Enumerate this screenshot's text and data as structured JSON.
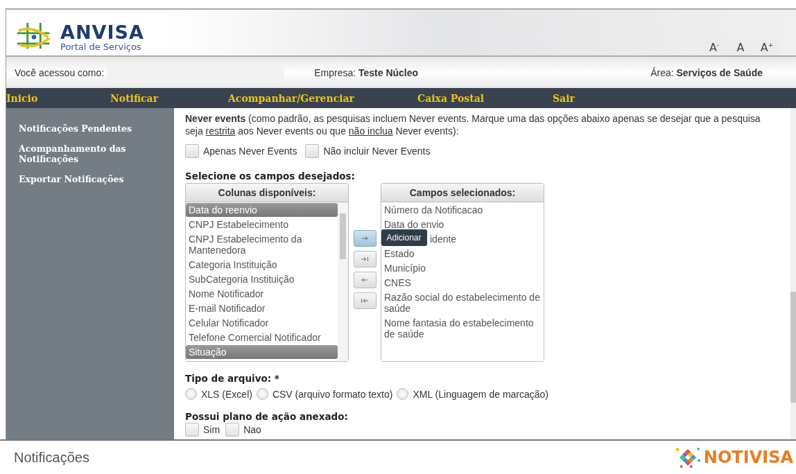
{
  "header": {
    "logo_title": "ANVISA",
    "logo_subtitle": "Portal de Serviços",
    "font_buttons": [
      {
        "main": "A",
        "sup": "-"
      },
      {
        "main": "A"
      },
      {
        "main": "A",
        "sup": "+"
      }
    ]
  },
  "info_bar": {
    "user_label": "Você acessou como:",
    "company_label": "Empresa:",
    "company": "Teste Núcleo",
    "area_label": "Área:",
    "area": "Serviços de Saúde"
  },
  "nav": [
    "Inicio",
    "Notificar",
    "Acompanhar/Gerenciar",
    "Caixa Postal",
    "Sair"
  ],
  "sidebar": {
    "items": [
      "Notificações Pendentes",
      "Acompanhamento das Notificações",
      "Exportar Notificações"
    ]
  },
  "never_events": {
    "text": [
      {
        "text": "**Never events** (como padrão, as pesquisas incluem Never events. Marque uma das opções abaixo apenas se desejar que a pesquisa seja ",
        "underline": false
      },
      {
        "text": "restrita",
        "underline": true
      },
      {
        "text": " aos Never events ou que ",
        "underline": false
      },
      {
        "text": "não inclua",
        "underline": true
      },
      {
        "text": " Never events):",
        "underline": false
      }
    ],
    "options": [
      {
        "label": "Apenas Never Events",
        "checked": false
      },
      {
        "label": "Não incluir Never Events",
        "checked": false
      }
    ]
  },
  "fields": {
    "title": "Selecione os campos desejados:",
    "available_title": "Colunas disponíveis:",
    "available": [
      {
        "label": "Data do reenvio",
        "selected": true
      },
      {
        "label": "CNPJ Estabelecimento",
        "selected": false
      },
      {
        "label": "CNPJ Estabelecimento da Mantenedora",
        "selected": false
      },
      {
        "label": "Categoria Instituição",
        "selected": false
      },
      {
        "label": "SubCategoria Instituição",
        "selected": false
      },
      {
        "label": "Nome Notificador",
        "selected": false
      },
      {
        "label": "E-mail Notificador",
        "selected": false
      },
      {
        "label": "Celular Notificador",
        "selected": false
      },
      {
        "label": "Telefone Comercial Notificador",
        "selected": false
      },
      {
        "label": "Situação",
        "selected": true
      }
    ],
    "buttons": [
      {
        "kind": "add",
        "active": true
      },
      {
        "kind": "add_all",
        "active": false
      },
      {
        "kind": "remove",
        "active": false
      },
      {
        "kind": "remove_all",
        "active": false
      }
    ],
    "tooltip": "Adicionar",
    "selected_title": "Campos selecionados:",
    "selected_fields": [
      {
        "label": "Número da Notificacao",
        "covered": false
      },
      {
        "label": "Data do envio",
        "covered": false
      },
      {
        "label": "idente",
        "covered": true
      },
      {
        "label": "Estado",
        "covered": false
      },
      {
        "label": "Município",
        "covered": false
      },
      {
        "label": "CNES",
        "covered": false
      },
      {
        "label": "Razão social do estabelecimento de saúde",
        "covered": false
      },
      {
        "label": "Nome fantasia do estabelecimento de saúde",
        "covered": false
      }
    ]
  },
  "file_type": {
    "title": "Tipo de arquivo: *",
    "options": [
      {
        "label": "XLS (Excel)",
        "selected": false
      },
      {
        "label": "CSV (arquivo formato texto)",
        "selected": false
      },
      {
        "label": "XML (Linguagem de marcação)",
        "selected": false
      }
    ]
  },
  "action_plan": {
    "title": "Possui plano de ação anexado:",
    "options": [
      {
        "label": "Sim",
        "checked": false
      },
      {
        "label": "Nao",
        "checked": false
      }
    ]
  },
  "footer": {
    "title": "Notificações",
    "logo": "NOTIVISA"
  }
}
